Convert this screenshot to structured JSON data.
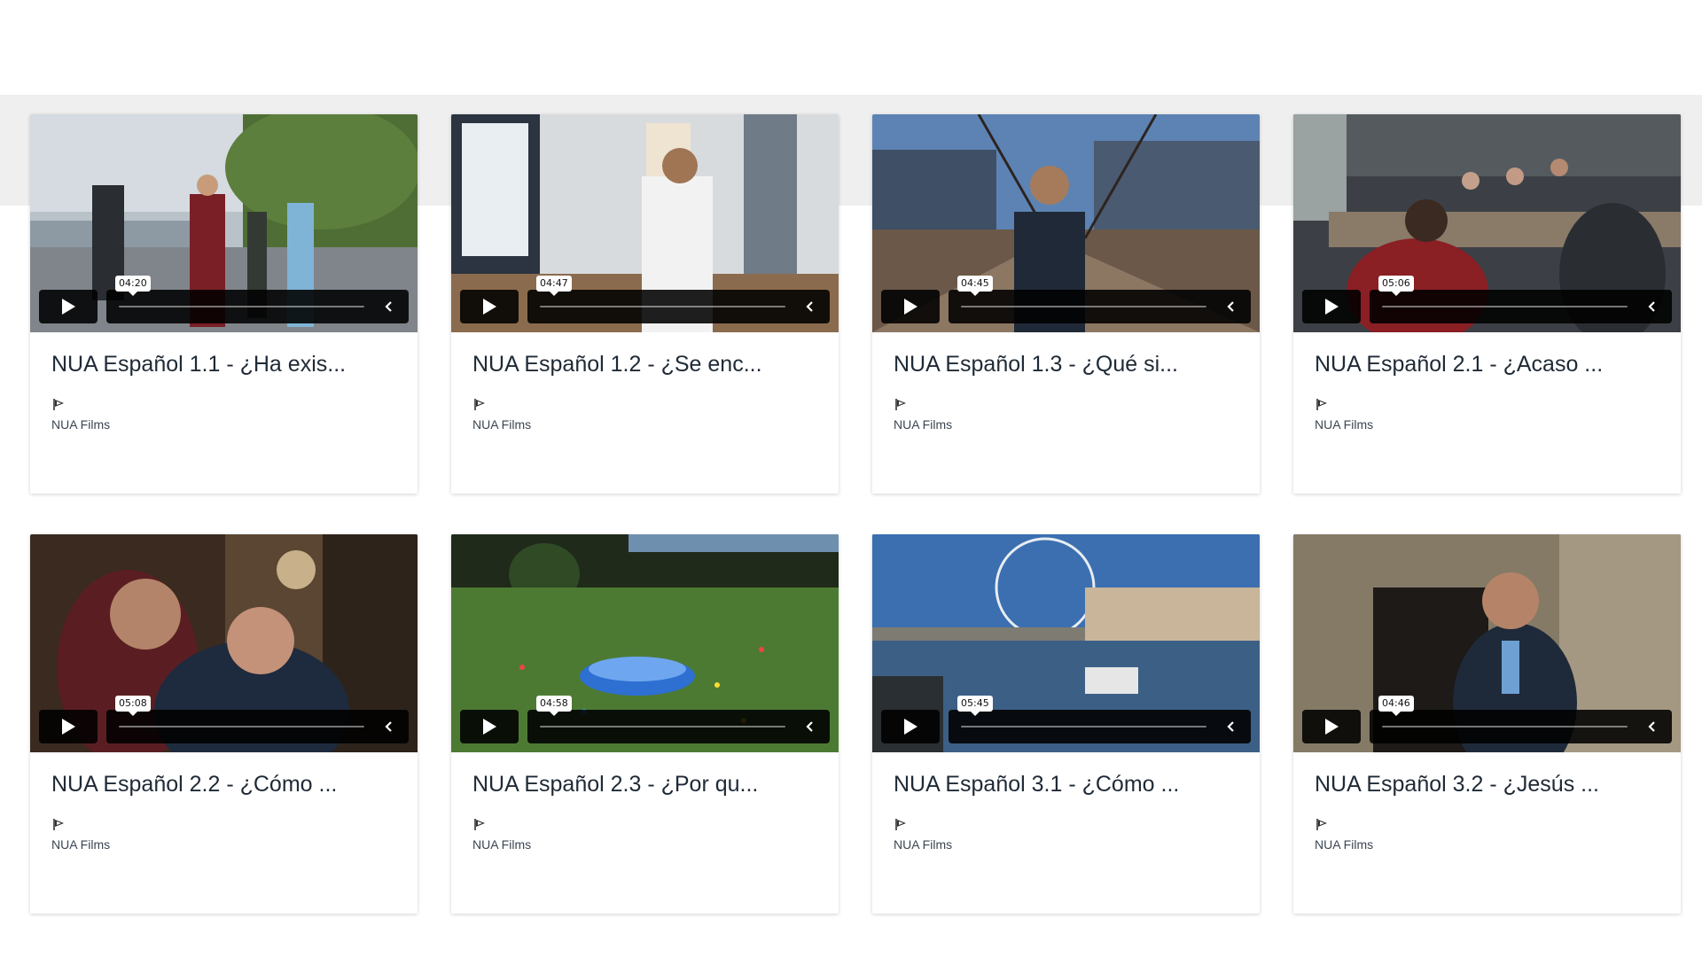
{
  "videos": [
    {
      "title": "NUA Español 1.1 - ¿Ha exis...",
      "channel": "NUA Films",
      "duration": "04:20"
    },
    {
      "title": "NUA Español 1.2 - ¿Se enc...",
      "channel": "NUA Films",
      "duration": "04:47"
    },
    {
      "title": "NUA Español 1.3 - ¿Qué si...",
      "channel": "NUA Films",
      "duration": "04:45"
    },
    {
      "title": "NUA Español 2.1 - ¿Acaso ...",
      "channel": "NUA Films",
      "duration": "05:06"
    },
    {
      "title": "NUA Español 2.2 - ¿Cómo ...",
      "channel": "NUA Films",
      "duration": "05:08"
    },
    {
      "title": "NUA Español 2.3 - ¿Por qu...",
      "channel": "NUA Films",
      "duration": "04:58"
    },
    {
      "title": "NUA Español 3.1 - ¿Cómo ...",
      "channel": "NUA Films",
      "duration": "05:45"
    },
    {
      "title": "NUA Español 3.2 - ¿Jesús ...",
      "channel": "NUA Films",
      "duration": "04:46"
    }
  ],
  "icons": {
    "play": "play-icon",
    "collapse": "chevron-left-icon",
    "channel_logo": "nua-flag-logo-icon"
  },
  "colors": {
    "title_text": "#1f2a36",
    "channel_text": "#3b4652",
    "band_gray": "#efefef",
    "control_bg": "#000000"
  }
}
